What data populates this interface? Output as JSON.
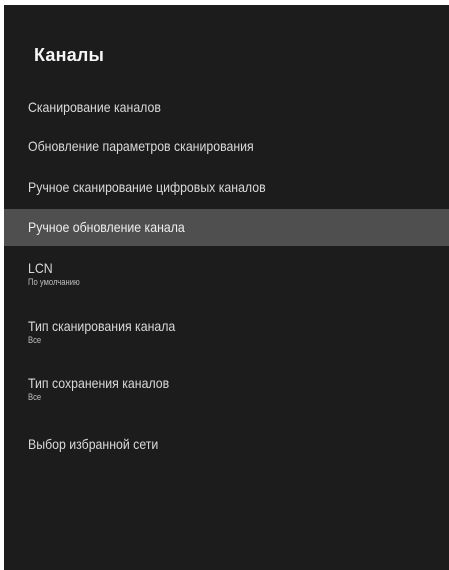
{
  "panel": {
    "title": "Каналы"
  },
  "menu": {
    "items": [
      {
        "label": "Сканирование каналов"
      },
      {
        "label": "Обновление параметров сканирования"
      },
      {
        "label": "Ручное сканирование цифровых каналов"
      },
      {
        "label": "Ручное обновление канала",
        "selected": true
      },
      {
        "label": "LCN",
        "value": "По умолчанию"
      },
      {
        "label": "Тип сканирования канала",
        "value": "Все"
      },
      {
        "label": "Тип сохранения каналов",
        "value": "Все"
      },
      {
        "label": "Выбор избранной сети"
      }
    ]
  },
  "colors": {
    "background": "#1c1c1c",
    "highlight": "#4f4f4f",
    "text": "#d9d9d9"
  }
}
